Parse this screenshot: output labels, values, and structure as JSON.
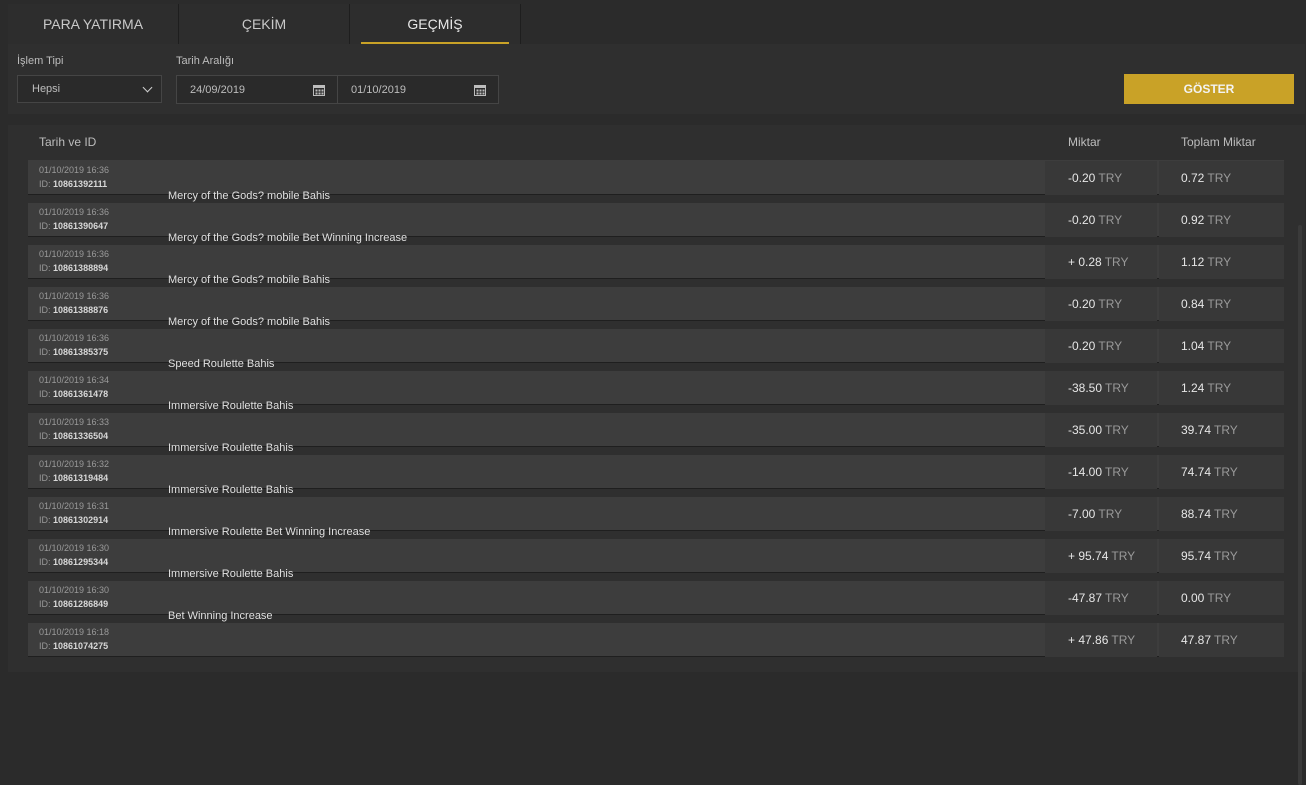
{
  "tabs": [
    {
      "label": "PARA YATIRMA"
    },
    {
      "label": "ÇEKİM"
    },
    {
      "label": "GEÇMİŞ"
    }
  ],
  "filters": {
    "type_label": "İşlem Tipi",
    "type_value": "Hepsi",
    "range_label": "Tarih Aralığı",
    "date_from": "24/09/2019",
    "date_to": "01/10/2019",
    "show_button": "GÖSTER"
  },
  "table": {
    "headers": {
      "date_id": "Tarih ve ID",
      "amount": "Miktar",
      "total": "Toplam Miktar"
    },
    "currency": "TRY",
    "id_prefix": "ID:",
    "rows": [
      {
        "date": "01/10/2019 16:36",
        "id": "10861392111",
        "amount": "-0.20",
        "total": "0.72",
        "desc": "Mercy of the Gods? mobile Bahis"
      },
      {
        "date": "01/10/2019 16:36",
        "id": "10861390647",
        "amount": "-0.20",
        "total": "0.92",
        "desc": "Mercy of the Gods? mobile Bet Winning Increase"
      },
      {
        "date": "01/10/2019 16:36",
        "id": "10861388894",
        "amount": "+ 0.28",
        "total": "1.12",
        "desc": "Mercy of the Gods? mobile Bahis"
      },
      {
        "date": "01/10/2019 16:36",
        "id": "10861388876",
        "amount": "-0.20",
        "total": "0.84",
        "desc": "Mercy of the Gods? mobile Bahis"
      },
      {
        "date": "01/10/2019 16:36",
        "id": "10861385375",
        "amount": "-0.20",
        "total": "1.04",
        "desc": "Speed Roulette Bahis"
      },
      {
        "date": "01/10/2019 16:34",
        "id": "10861361478",
        "amount": "-38.50",
        "total": "1.24",
        "desc": "Immersive Roulette Bahis"
      },
      {
        "date": "01/10/2019 16:33",
        "id": "10861336504",
        "amount": "-35.00",
        "total": "39.74",
        "desc": "Immersive Roulette Bahis"
      },
      {
        "date": "01/10/2019 16:32",
        "id": "10861319484",
        "amount": "-14.00",
        "total": "74.74",
        "desc": "Immersive Roulette Bahis"
      },
      {
        "date": "01/10/2019 16:31",
        "id": "10861302914",
        "amount": "-7.00",
        "total": "88.74",
        "desc": "Immersive Roulette Bet Winning Increase"
      },
      {
        "date": "01/10/2019 16:30",
        "id": "10861295344",
        "amount": "+ 95.74",
        "total": "95.74",
        "desc": "Immersive Roulette Bahis"
      },
      {
        "date": "01/10/2019 16:30",
        "id": "10861286849",
        "amount": "-47.87",
        "total": "0.00",
        "desc": "Bet Winning Increase"
      },
      {
        "date": "01/10/2019 16:18",
        "id": "10861074275",
        "amount": "+ 47.86",
        "total": "47.87",
        "desc": ""
      }
    ]
  },
  "colors": {
    "accent": "#c9a227",
    "background": "#2b2b2b",
    "row": "#3d3d3d"
  }
}
